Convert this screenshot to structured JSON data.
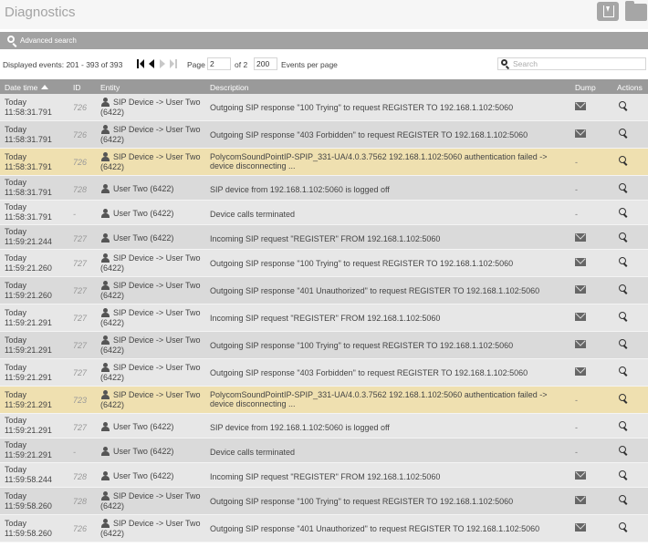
{
  "header": {
    "title": "Diagnostics",
    "icons": [
      "download-icon",
      "folder-icon"
    ]
  },
  "advanced_search": {
    "label": "Advanced search",
    "icon": "search-icon"
  },
  "pager": {
    "displayed": "Displayed events: 201 - 393 of 393",
    "page_label": "Page",
    "page_value": "2",
    "of_label": "of 2",
    "per_page_value": "200",
    "per_page_label": "Events per page",
    "search_placeholder": "Search"
  },
  "columns": {
    "date": "Date time",
    "id": "ID",
    "entity": "Entity",
    "description": "Description",
    "dump": "Dump",
    "actions": "Actions"
  },
  "rows": [
    {
      "date": "Today",
      "time": "11:58:31.791",
      "id": "726",
      "entity1": "SIP Device -> User Two",
      "entity2": "(6422)",
      "desc": "Outgoing SIP response \"100 Trying\" to request REGISTER TO 192.168.1.102:5060",
      "dump": "mail",
      "hl": false
    },
    {
      "date": "Today",
      "time": "11:58:31.791",
      "id": "726",
      "entity1": "SIP Device -> User Two",
      "entity2": "(6422)",
      "desc": "Outgoing SIP response \"403 Forbidden\" to request REGISTER TO 192.168.1.102:5060",
      "dump": "mail",
      "hl": false
    },
    {
      "date": "Today",
      "time": "11:58:31.791",
      "id": "726",
      "entity1": "SIP Device -> User Two",
      "entity2": "(6422)",
      "desc": "PolycomSoundPointIP-SPIP_331-UA/4.0.3.7562 192.168.1.102:5060 authentication failed -> device disconnecting ...",
      "dump": "-",
      "hl": true
    },
    {
      "date": "Today",
      "time": "11:58:31.791",
      "id": "728",
      "entity1": "User Two (6422)",
      "entity2": "",
      "desc": "SIP device from 192.168.1.102:5060 is logged off",
      "dump": "-",
      "hl": false
    },
    {
      "date": "Today",
      "time": "11:58:31.791",
      "id": "-",
      "entity1": "User Two (6422)",
      "entity2": "",
      "desc": "Device calls terminated",
      "dump": "-",
      "hl": false
    },
    {
      "date": "Today",
      "time": "11:59:21.244",
      "id": "727",
      "entity1": "User Two (6422)",
      "entity2": "",
      "desc": "Incoming SIP request \"REGISTER\" FROM 192.168.1.102:5060",
      "dump": "mail",
      "hl": false
    },
    {
      "date": "Today",
      "time": "11:59:21.260",
      "id": "727",
      "entity1": "SIP Device -> User Two",
      "entity2": "(6422)",
      "desc": "Outgoing SIP response \"100 Trying\" to request REGISTER TO 192.168.1.102:5060",
      "dump": "mail",
      "hl": false
    },
    {
      "date": "Today",
      "time": "11:59:21.260",
      "id": "727",
      "entity1": "SIP Device -> User Two",
      "entity2": "(6422)",
      "desc": "Outgoing SIP response \"401 Unauthorized\" to request REGISTER TO 192.168.1.102:5060",
      "dump": "mail",
      "hl": false
    },
    {
      "date": "Today",
      "time": "11:59:21.291",
      "id": "727",
      "entity1": "SIP Device -> User Two",
      "entity2": "(6422)",
      "desc": "Incoming SIP request \"REGISTER\" FROM 192.168.1.102:5060",
      "dump": "mail",
      "hl": false
    },
    {
      "date": "Today",
      "time": "11:59:21.291",
      "id": "727",
      "entity1": "SIP Device -> User Two",
      "entity2": "(6422)",
      "desc": "Outgoing SIP response \"100 Trying\" to request REGISTER TO 192.168.1.102:5060",
      "dump": "mail",
      "hl": false
    },
    {
      "date": "Today",
      "time": "11:59:21.291",
      "id": "727",
      "entity1": "SIP Device -> User Two",
      "entity2": "(6422)",
      "desc": "Outgoing SIP response \"403 Forbidden\" to request REGISTER TO 192.168.1.102:5060",
      "dump": "mail",
      "hl": false
    },
    {
      "date": "Today",
      "time": "11:59:21.291",
      "id": "723",
      "entity1": "SIP Device -> User Two",
      "entity2": "(6422)",
      "desc": "PolycomSoundPointIP-SPIP_331-UA/4.0.3.7562 192.168.1.102:5060 authentication failed -> device disconnecting ...",
      "dump": "-",
      "hl": true
    },
    {
      "date": "Today",
      "time": "11:59:21.291",
      "id": "727",
      "entity1": "User Two (6422)",
      "entity2": "",
      "desc": "SIP device from 192.168.1.102:5060 is logged off",
      "dump": "-",
      "hl": false
    },
    {
      "date": "Today",
      "time": "11:59:21.291",
      "id": "-",
      "entity1": "User Two (6422)",
      "entity2": "",
      "desc": "Device calls terminated",
      "dump": "-",
      "hl": false
    },
    {
      "date": "Today",
      "time": "11:59:58.244",
      "id": "728",
      "entity1": "User Two (6422)",
      "entity2": "",
      "desc": "Incoming SIP request \"REGISTER\" FROM 192.168.1.102:5060",
      "dump": "mail",
      "hl": false
    },
    {
      "date": "Today",
      "time": "11:59:58.260",
      "id": "728",
      "entity1": "SIP Device -> User Two",
      "entity2": "(6422)",
      "desc": "Outgoing SIP response \"100 Trying\" to request REGISTER TO 192.168.1.102:5060",
      "dump": "mail",
      "hl": false
    },
    {
      "date": "Today",
      "time": "11:59:58.260",
      "id": "726",
      "entity1": "SIP Device -> User Two",
      "entity2": "(6422)",
      "desc": "Outgoing SIP response \"401 Unauthorized\" to request REGISTER TO 192.168.1.102:5060",
      "dump": "mail",
      "hl": false
    }
  ]
}
